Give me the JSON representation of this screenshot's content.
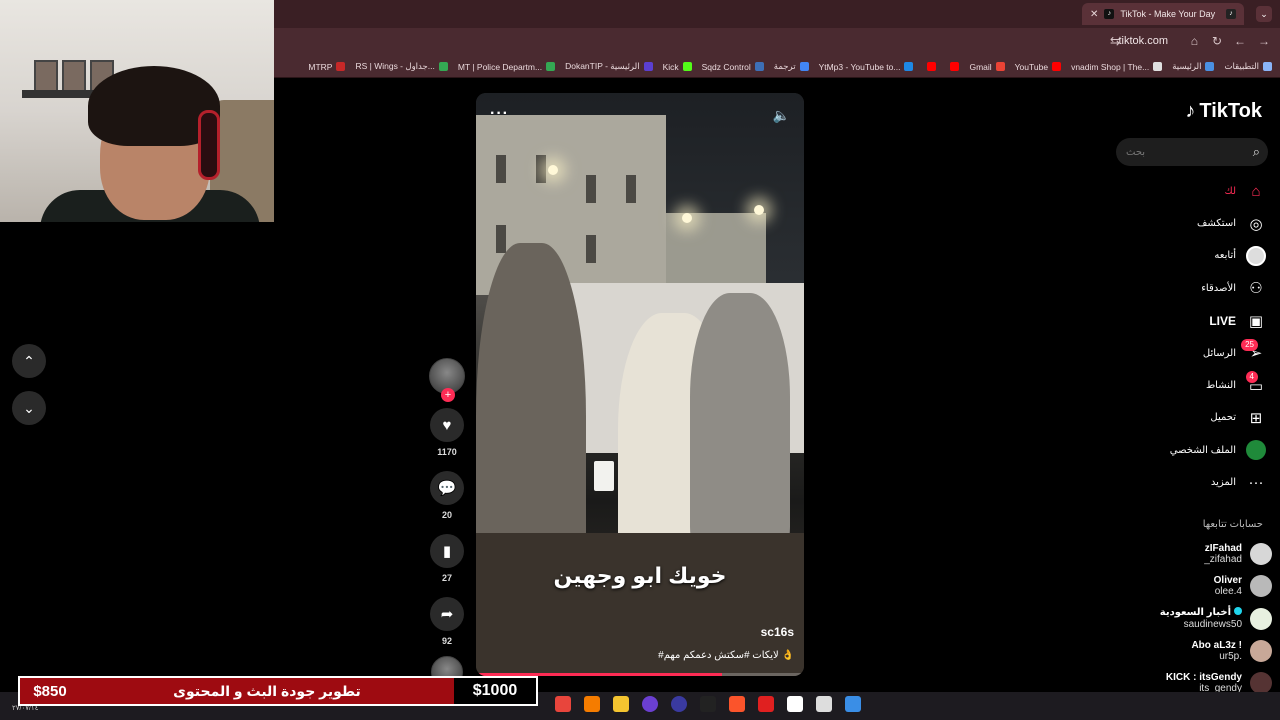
{
  "browser": {
    "tab_title": "TikTok - Make Your Day",
    "url": "tiktok.com",
    "bookmarks": [
      {
        "label": "التطبيقات",
        "color": "#8ab4f8"
      },
      {
        "label": "الرئيسية",
        "color": "#4a90e2"
      },
      {
        "label": "vnadim Shop | The...",
        "color": "#e0e0e0"
      },
      {
        "label": "YouTube",
        "color": "#ff0000"
      },
      {
        "label": "Gmail",
        "color": "#ea4335"
      },
      {
        "label": "",
        "color": "#ff0000"
      },
      {
        "label": "",
        "color": "#ff0000"
      },
      {
        "label": "YtMp3 - YouTube to...",
        "color": "#1e88e5"
      },
      {
        "label": "ترجمة",
        "color": "#4285f4"
      },
      {
        "label": "Sqdz Control",
        "color": "#3d6fb6"
      },
      {
        "label": "Kick",
        "color": "#53fc18"
      },
      {
        "label": "DokanTIP - الرئيسية",
        "color": "#5b3fd1"
      },
      {
        "label": "MT | Police Departm...",
        "color": "#34a853"
      },
      {
        "label": "RS | Wings - جداول...",
        "color": "#34a853"
      },
      {
        "label": "MTRP",
        "color": "#c62828"
      }
    ]
  },
  "tiktok": {
    "logo": "TikTok",
    "search_placeholder": "بحث",
    "nav": [
      {
        "label": "لك",
        "icon": "home-icon",
        "active": true
      },
      {
        "label": "استكشف",
        "icon": "compass-icon"
      },
      {
        "label": "أتابعه",
        "icon": "following-avatar-icon"
      },
      {
        "label": "الأصدقاء",
        "icon": "friends-icon"
      },
      {
        "label": "LIVE",
        "icon": "live-icon"
      },
      {
        "label": "الرسائل",
        "icon": "messages-icon",
        "badge": "25"
      },
      {
        "label": "النشاط",
        "icon": "activity-icon",
        "badge": "4"
      },
      {
        "label": "تحميل",
        "icon": "upload-icon"
      },
      {
        "label": "الملف الشخصي",
        "icon": "profile-avatar-icon"
      },
      {
        "label": "المزيد",
        "icon": "more-icon"
      }
    ],
    "following_title": "حسابات تتابعها",
    "following": [
      {
        "name": "zIFahad",
        "handle": "_zifahad",
        "verified": false,
        "avatar_color": "#d7d7d7"
      },
      {
        "name": "Oliver",
        "handle": "olee.4",
        "verified": false,
        "avatar_color": "#b9b9b9"
      },
      {
        "name": "أخبار السعودية",
        "handle": "saudinews50",
        "verified": true,
        "avatar_color": "#e8f0e0"
      },
      {
        "name": "Abo aL3z !",
        "handle": "ur5p.",
        "verified": false,
        "avatar_color": "#c8a898"
      },
      {
        "name": "KICK : itsGendy",
        "handle": "its_gendy",
        "verified": false,
        "avatar_color": "#553333"
      }
    ]
  },
  "video": {
    "overlay_text": "خويك ابو وجهين",
    "username": "sc16s",
    "caption": "#لايكات #سكتش دعمكم مهم 👌",
    "progress": 0.75
  },
  "actions": {
    "likes": "1170",
    "comments": "20",
    "saves": "27",
    "shares": "92"
  },
  "donation": {
    "current": "$850",
    "title": "تطوير جودة البث و المحتوى",
    "goal": "$1000"
  },
  "taskbar": {
    "clock": "٢٧/٠٧/١٤"
  },
  "colors": {
    "accent": "#fe2c55",
    "chrome_bg": "#3a1f24",
    "donation_bg": "#9e0b11"
  }
}
